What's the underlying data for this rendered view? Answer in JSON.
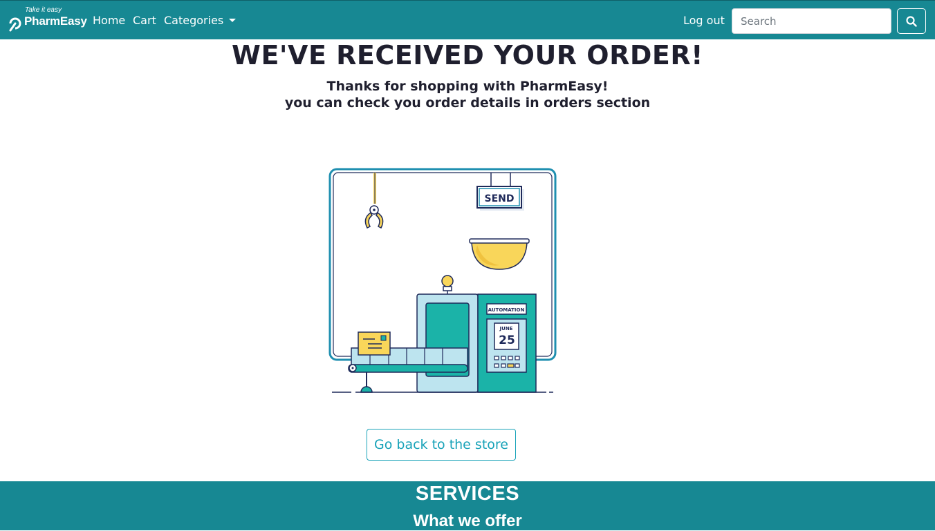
{
  "brand": {
    "tagline": "Take it easy",
    "name": "PharmEasy"
  },
  "nav": {
    "home": "Home",
    "cart": "Cart",
    "categories": "Categories",
    "logout": "Log out",
    "search_placeholder": "Search"
  },
  "main": {
    "headline": "WE'VE RECEIVED YOUR ORDER!",
    "thanks": "Thanks for shopping with PharmEasy!",
    "details": "you can check you order details in orders section",
    "back_button": "Go back to the store"
  },
  "illustration": {
    "send_label": "SEND",
    "machine_label": "AUTOMATION",
    "calendar_month": "JUNE",
    "calendar_day": "25"
  },
  "services": {
    "title": "SERVICES",
    "subtitle": "What we offer"
  },
  "colors": {
    "navbar": "#178893",
    "accent": "#17a2b8",
    "teal": "#1bb3a8",
    "yellow": "#f9d65a",
    "dark": "#1f2a5a"
  }
}
